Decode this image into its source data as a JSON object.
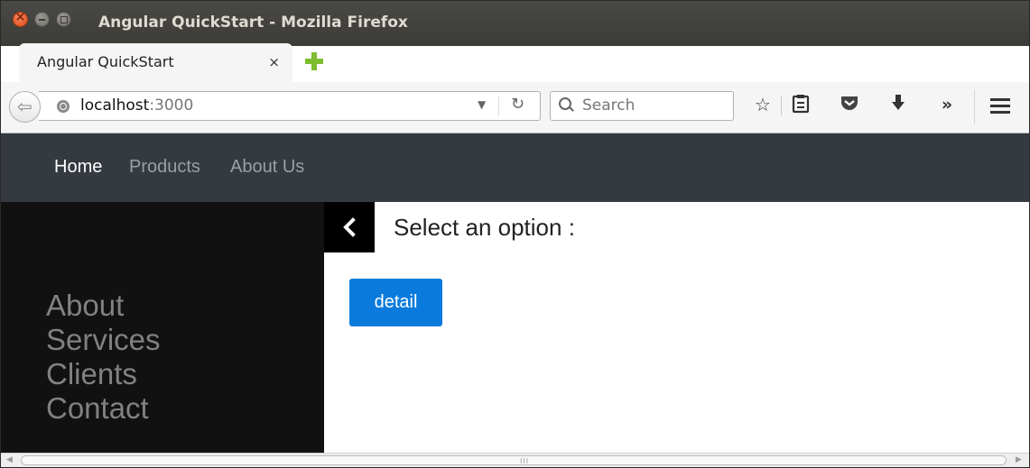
{
  "window": {
    "title": "Angular QuickStart - Mozilla Firefox"
  },
  "tabs": [
    {
      "label": "Angular QuickStart",
      "close": "×"
    }
  ],
  "toolbar": {
    "url_host": "localhost",
    "url_port": ":3000",
    "search_placeholder": "Search",
    "icons": [
      "back-icon",
      "globe-icon",
      "dropdown-icon",
      "reload-icon",
      "search-icon",
      "bookmark-star-icon",
      "reading-list-icon",
      "pocket-icon",
      "download-icon",
      "overflow-icon",
      "menu-icon"
    ]
  },
  "site_nav": {
    "links": [
      "Home",
      "Products",
      "About Us"
    ],
    "active": "Home"
  },
  "sidebar": {
    "links": [
      "About",
      "Services",
      "Clients",
      "Contact"
    ]
  },
  "content": {
    "heading": "Select an option :",
    "button_label": "detail"
  },
  "colors": {
    "navbar_bg": "#343a40",
    "sidebar_bg": "#111111",
    "button_bg": "#0a7bdc",
    "new_tab_icon": "#7dbd2f"
  }
}
